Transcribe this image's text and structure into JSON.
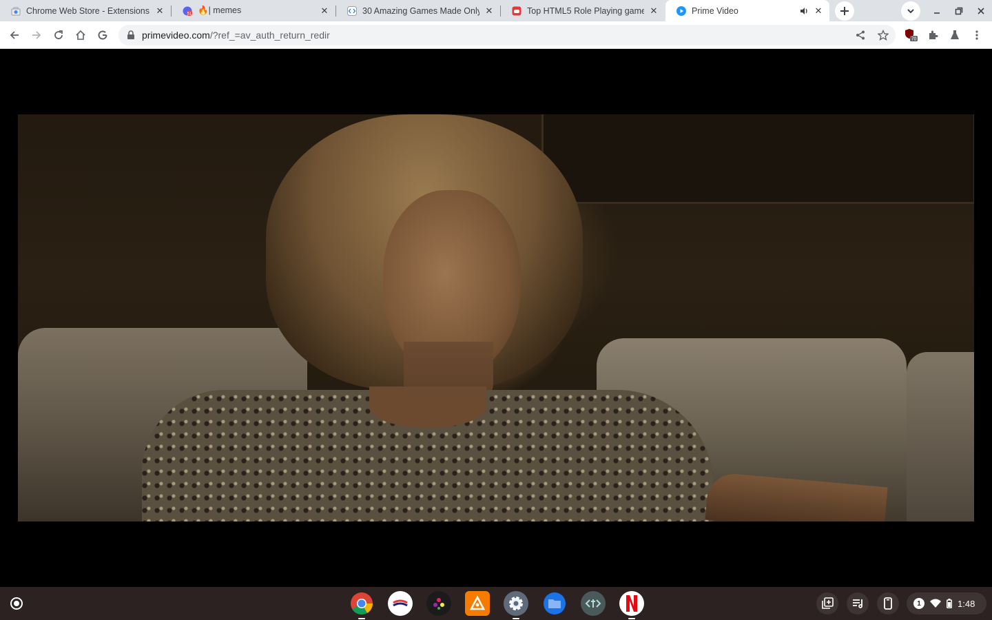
{
  "tabs": [
    {
      "title": "Chrome Web Store - Extensions",
      "favicon": "chrome-web-store-icon"
    },
    {
      "title": "🔥| memes",
      "favicon": "discord-notification-icon",
      "badge": "51"
    },
    {
      "title": "30 Amazing Games Made Only W",
      "favicon": "code-icon"
    },
    {
      "title": "Top HTML5 Role Playing games",
      "favicon": "game-icon"
    },
    {
      "title": "Prime Video",
      "favicon": "prime-video-icon",
      "active": true,
      "muted_icon": "speaker-icon"
    }
  ],
  "address_bar": {
    "host": "primevideo.com",
    "path": "/?ref_=av_auth_return_redir"
  },
  "extensions": {
    "shield_badge": "70"
  },
  "shelf": {
    "apps": [
      "chrome",
      "paint-app",
      "dark-app",
      "orange-app",
      "settings",
      "files",
      "text-app",
      "netflix"
    ],
    "time": "1:48",
    "notification_count": "1"
  },
  "colors": {
    "tabstrip": "#dee1e6",
    "shelf": "#2d2222",
    "netflix": "#e50914",
    "files": "#1a73e8"
  }
}
